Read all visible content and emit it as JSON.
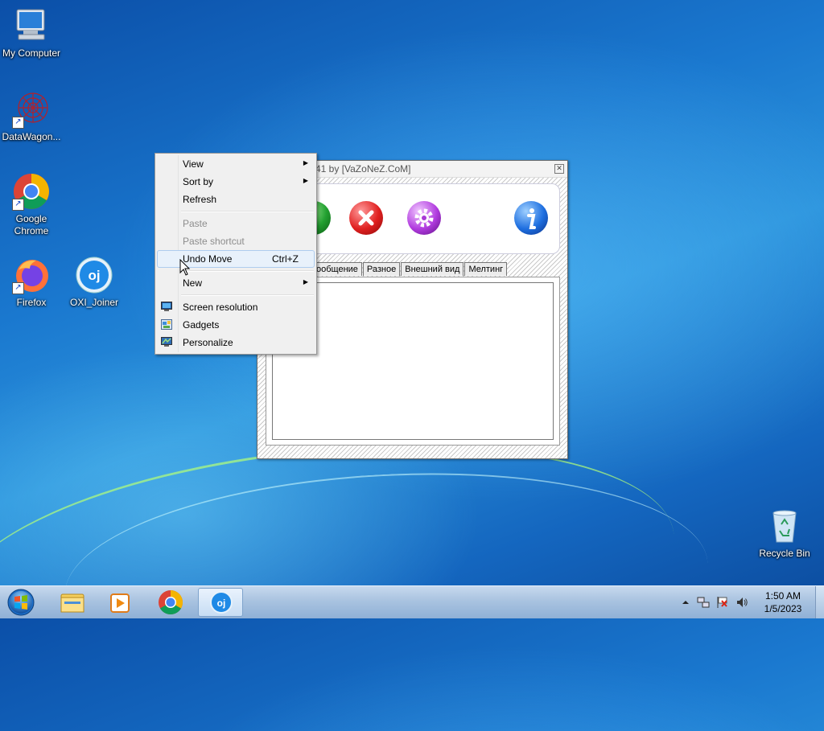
{
  "desktop": {
    "icons": [
      {
        "label": "My Computer",
        "icon": "computer-icon"
      },
      {
        "label": "DataWagon...",
        "icon": "datawagon-icon"
      },
      {
        "label": "Google Chrome",
        "icon": "chrome-icon"
      },
      {
        "label": "Firefox",
        "icon": "firefox-icon"
      },
      {
        "label": "OXI_Joiner",
        "icon": "oxi-joiner-icon"
      },
      {
        "label": "Recycle Bin",
        "icon": "recycle-bin-icon"
      }
    ]
  },
  "app_window": {
    "title": "41 by [VaZoNeZ.CoM]",
    "tabs": [
      "ообщение",
      "Разное",
      "Внешний вид",
      "Мелтинг"
    ]
  },
  "context_menu": {
    "items": [
      {
        "label": "View",
        "submenu": true,
        "enabled": true
      },
      {
        "label": "Sort by",
        "submenu": true,
        "enabled": true
      },
      {
        "label": "Refresh",
        "enabled": true
      },
      {
        "label": "Paste",
        "enabled": false
      },
      {
        "label": "Paste shortcut",
        "enabled": false
      },
      {
        "label": "Undo Move",
        "shortcut": "Ctrl+Z",
        "enabled": true,
        "highlighted": true
      },
      {
        "label": "New",
        "submenu": true,
        "enabled": true
      },
      {
        "label": "Screen resolution",
        "icon": "screen-resolution-icon",
        "enabled": true
      },
      {
        "label": "Gadgets",
        "icon": "gadgets-icon",
        "enabled": true
      },
      {
        "label": "Personalize",
        "icon": "personalize-icon",
        "enabled": true
      }
    ]
  },
  "taskbar": {
    "pinned": [
      "windows-explorer",
      "media-player",
      "google-chrome",
      "oxi-joiner"
    ],
    "active": "oxi-joiner"
  },
  "tray": {
    "time": "1:50 AM",
    "date": "1/5/2023"
  }
}
